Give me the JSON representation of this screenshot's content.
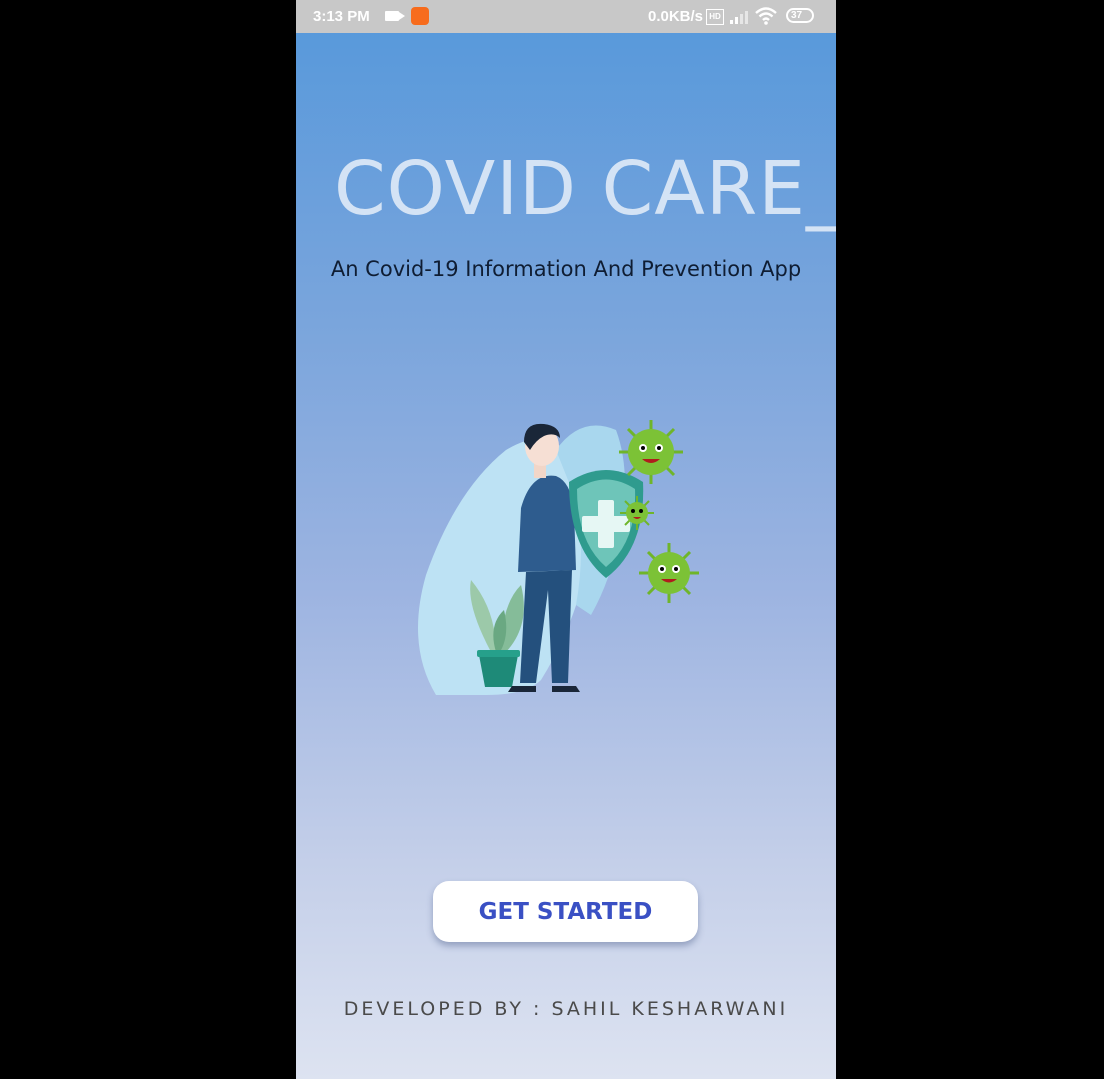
{
  "status_bar": {
    "time": "3:13 PM",
    "network_speed": "0.0KB/s",
    "battery_level": "37",
    "icons": [
      "video-camera-icon",
      "app-notification-icon",
      "hd-icon",
      "signal-icon",
      "wifi-icon",
      "battery-icon"
    ]
  },
  "splash": {
    "title": "COVID CARE_",
    "subtitle": "An Covid-19 Information And Prevention App",
    "illustration": "person-shield-virus-illustration",
    "cta_label": "GET STARTED",
    "footer": "DEVELOPED BY : SAHIL KESHARWANI"
  },
  "colors": {
    "gradient_top": "#5598db",
    "gradient_bottom": "#dde3f1",
    "title": "#d4e3f5",
    "cta_text": "#3a50c4"
  }
}
